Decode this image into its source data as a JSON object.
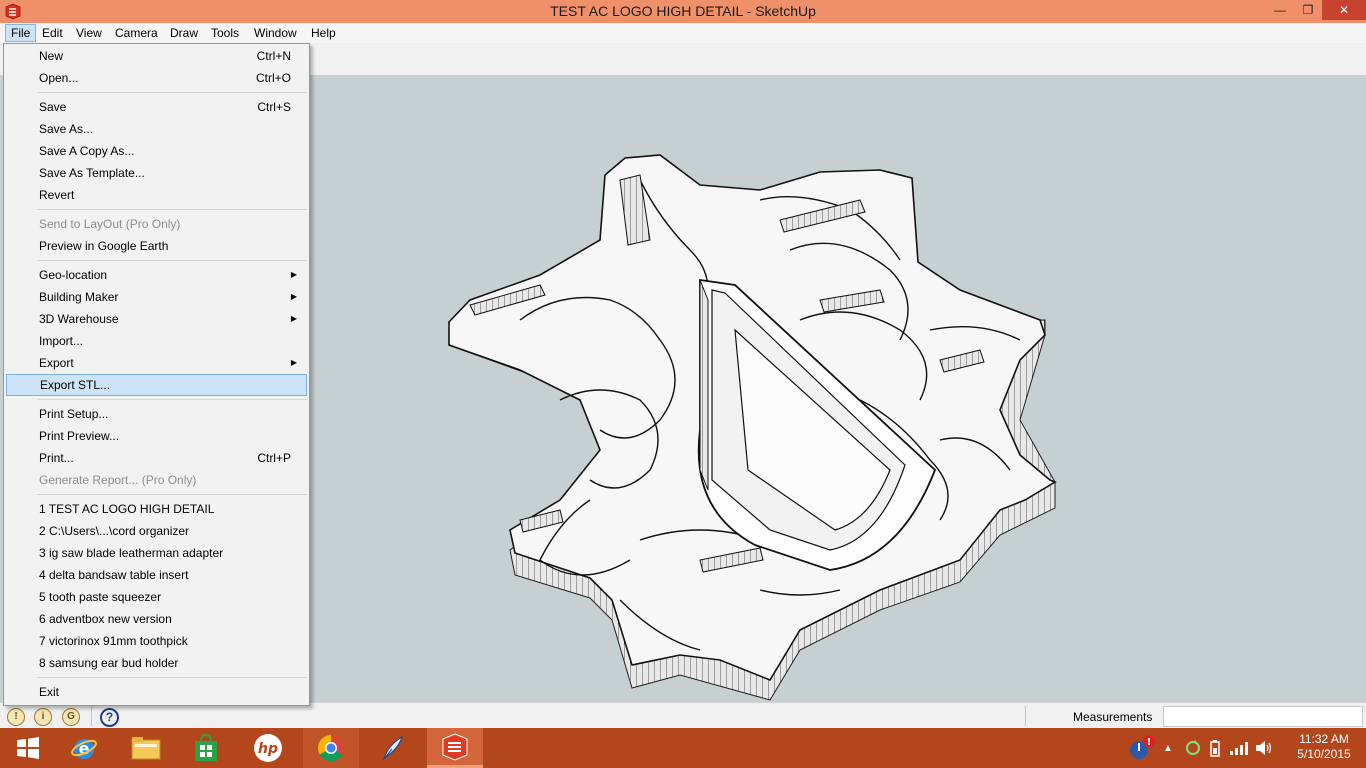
{
  "window": {
    "title": "TEST AC LOGO HIGH DETAIL - SketchUp"
  },
  "menubar": [
    "File",
    "Edit",
    "View",
    "Camera",
    "Draw",
    "Tools",
    "Window",
    "Help"
  ],
  "file_menu": {
    "new": {
      "label": "New",
      "shortcut": "Ctrl+N"
    },
    "open": {
      "label": "Open...",
      "shortcut": "Ctrl+O"
    },
    "save": {
      "label": "Save",
      "shortcut": "Ctrl+S"
    },
    "save_as": {
      "label": "Save As..."
    },
    "save_copy_as": {
      "label": "Save A Copy As..."
    },
    "save_as_template": {
      "label": "Save As Template..."
    },
    "revert": {
      "label": "Revert"
    },
    "send_to_layout": {
      "label": "Send to LayOut (Pro Only)",
      "disabled": true
    },
    "preview_google_earth": {
      "label": "Preview in Google Earth"
    },
    "geo_location": {
      "label": "Geo-location"
    },
    "building_maker": {
      "label": "Building Maker"
    },
    "warehouse": {
      "label": "3D Warehouse"
    },
    "import": {
      "label": "Import..."
    },
    "export": {
      "label": "Export"
    },
    "export_stl": {
      "label": "Export STL...",
      "highlighted": true
    },
    "print_setup": {
      "label": "Print Setup..."
    },
    "print_preview": {
      "label": "Print Preview..."
    },
    "print": {
      "label": "Print...",
      "shortcut": "Ctrl+P"
    },
    "generate_report": {
      "label": "Generate Report... (Pro Only)",
      "disabled": true
    },
    "recent": [
      "1 TEST AC LOGO HIGH DETAIL",
      "2 C:\\Users\\...\\cord organizer",
      "3 ig saw blade leatherman adapter",
      "4 delta bandsaw table insert",
      "5 tooth paste squeezer",
      "6 adventbox new version",
      "7 victorinox 91mm toothpick",
      "8 samsung ear bud holder"
    ],
    "exit": {
      "label": "Exit"
    }
  },
  "statusbar": {
    "measurements_label": "Measurements",
    "measurements_value": ""
  },
  "taskbar": {
    "time": "11:32 AM",
    "date": "5/10/2015"
  },
  "colors": {
    "titlebar": "#f0906a",
    "taskbar": "#b4461c",
    "viewport": "#c6d0d1",
    "menu_highlight": "#cde3f8"
  }
}
